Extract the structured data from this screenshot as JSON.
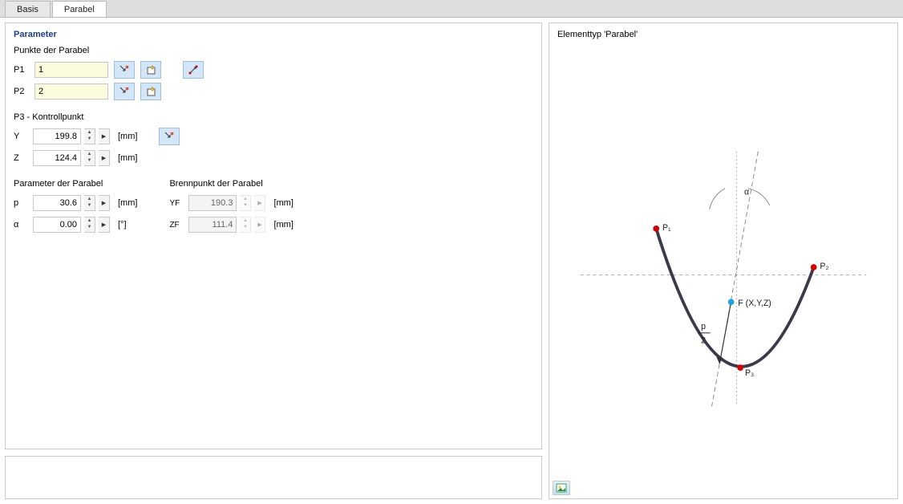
{
  "tabs": {
    "basis": "Basis",
    "parabel": "Parabel"
  },
  "panel_title": "Parameter",
  "section_points": "Punkte der Parabel",
  "p1": {
    "label": "P1",
    "value": "1"
  },
  "p2": {
    "label": "P2",
    "value": "2"
  },
  "section_control": "P3 - Kontrollpunkt",
  "y": {
    "label": "Y",
    "value": "199.8",
    "unit": "[mm]"
  },
  "z": {
    "label": "Z",
    "value": "124.4",
    "unit": "[mm]"
  },
  "section_param": "Parameter der Parabel",
  "p": {
    "label": "p",
    "value": "30.6",
    "unit": "[mm]"
  },
  "alpha": {
    "label": "α",
    "value": "0.00",
    "unit": "[°]"
  },
  "section_focus": "Brennpunkt der Parabel",
  "yf": {
    "label": "YF",
    "value": "190.3",
    "unit": "[mm]"
  },
  "zf": {
    "label": "ZF",
    "value": "111.4",
    "unit": "[mm]"
  },
  "diagram_title": "Elementtyp 'Parabel'",
  "diagram_labels": {
    "p1": "P₁",
    "p2": "P₂",
    "p3": "P₃",
    "f": "F (X,Y,Z)",
    "alpha": "α",
    "pover2": "p",
    "pover2_den": "2"
  }
}
